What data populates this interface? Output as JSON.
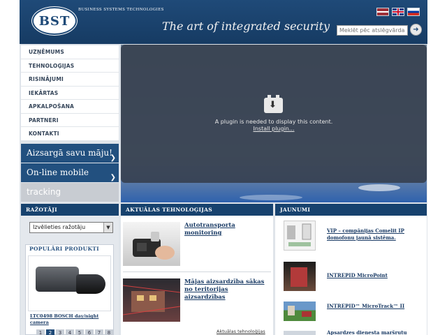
{
  "header": {
    "logo_text": "BST",
    "company_name": "BUSINESS SYSTEMS TECHNOLOGIES",
    "tagline": "The art of integrated security",
    "languages": [
      "lv",
      "en",
      "ru"
    ],
    "search": {
      "placeholder": "Meklēt pēc atslēgvārda..."
    }
  },
  "nav": {
    "items": [
      {
        "label": "UZŅĒMUMS"
      },
      {
        "label": "TEHNOLOĢIJAS"
      },
      {
        "label": "RISINĀJUMI"
      },
      {
        "label": "IEKĀRTAS"
      },
      {
        "label": "APKALPOŠANA"
      },
      {
        "label": "PARTNERI"
      },
      {
        "label": "KONTAKTI"
      }
    ]
  },
  "promos": {
    "protect_home": "Aizsargā savu māju!",
    "online_mobile": "On-line mobile",
    "tracking": "tracking"
  },
  "hero": {
    "plugin_message": "A plugin is needed to display this content.",
    "plugin_link": "Install plugin..."
  },
  "manufacturers": {
    "heading": "RAŽOTĀJI",
    "select_value": "Izvēlieties ražotāju",
    "popular_heading": "POPULĀRI PRODUKTI",
    "product_name": "LTC0498 BOSCH day/night camera",
    "pages": [
      "1",
      "2",
      "3",
      "4",
      "5",
      "6",
      "7",
      "8"
    ],
    "active_page": "2"
  },
  "technologies": {
    "heading": "AKTUĀLAS TEHNOLOĢIJAS",
    "items": [
      {
        "title": "Autotransporta monitoring"
      },
      {
        "title": "Mājas aizsardzība sākas no teritorijas aizsardzības"
      }
    ],
    "more_link": "Aktuālas tehnoloģijas"
  },
  "news": {
    "heading": "JAUNUMI",
    "items": [
      {
        "title": "VIP – compānijas Comelit IP domofonu jaunā sistēma."
      },
      {
        "title": "INTREPID MicroPoint"
      },
      {
        "title": "INTREPID™ MicroTrack™ II"
      },
      {
        "title": "Apsardzes dienesta maršrutu"
      }
    ]
  },
  "colors": {
    "brand_blue": "#1f4a78",
    "header_dark": "#17426e",
    "link": "#1b3c66"
  }
}
